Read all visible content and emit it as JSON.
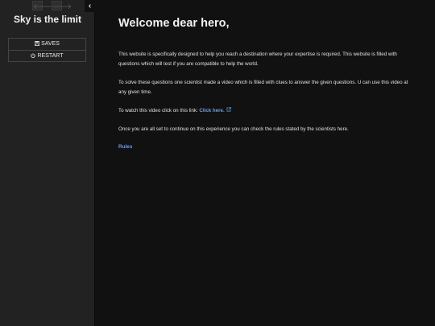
{
  "sidebar": {
    "nav": {
      "back_glyph": "🡐",
      "forward_glyph": "🡒",
      "collapse_glyph": "‹"
    },
    "story_title": "Sky is the limit",
    "menu": {
      "saves_icon": "floppy-icon",
      "saves_label": "SAVES",
      "restart_icon": "power-icon",
      "restart_label": "RESTART"
    }
  },
  "main": {
    "heading": "Welcome dear hero,",
    "paragraph1": "This website is specifically designed to help you reach a destination where your expertise is required. This website is filled with questions which will test if you are compatible to help the world.",
    "paragraph2": "To solve these questions one scientist made a video which is filled with clues to answer the given questions. U can use this video at any given time.",
    "paragraph3_prefix": "To watch this video click on this link: ",
    "paragraph3_link": "Click here.",
    "paragraph4": "Once you are all set to continue on this experience you can check the rules stated by the scientists here.",
    "rules_link": "Rules"
  },
  "colors": {
    "background": "#111111",
    "sidebar": "#222222",
    "link": "#6b9fe4"
  }
}
